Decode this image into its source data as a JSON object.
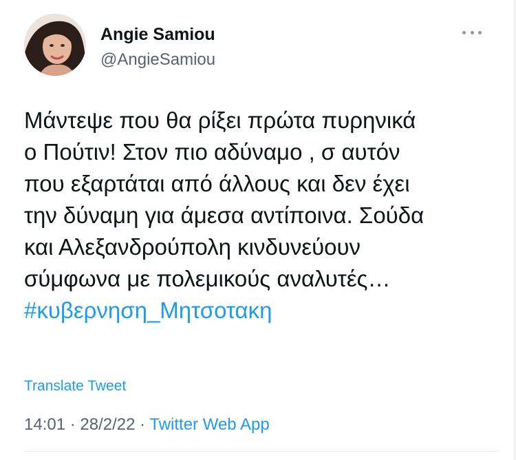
{
  "author": {
    "name": "Angie Samiou",
    "handle": "@AngieSamiou"
  },
  "tweet": {
    "lines": [
      "Μάντεψε που θα ρίξει πρώτα πυρηνικά",
      "ο Πούτιν! Στον πιο αδύναμο , σ αυτόν",
      "που εξαρτάται από άλλους και δεν έχει",
      "την δύναμη για άμεσα αντίποινα. Σούδα",
      "και Αλεξανδρούπολη κινδυνεύουν",
      "σύμφωνα με πολεμικούς αναλυτές…"
    ],
    "hashtag": "#κυβερνηση_Μητσοτακη"
  },
  "translate_label": "Translate Tweet",
  "meta": {
    "time": "14:01",
    "separator": " · ",
    "date": "28/2/22",
    "app": "Twitter Web App"
  },
  "colors": {
    "link": "#1d9bf0",
    "text": "#0f1419",
    "secondary": "#536471"
  },
  "icons": {
    "more": "more-horizontal-icon"
  }
}
